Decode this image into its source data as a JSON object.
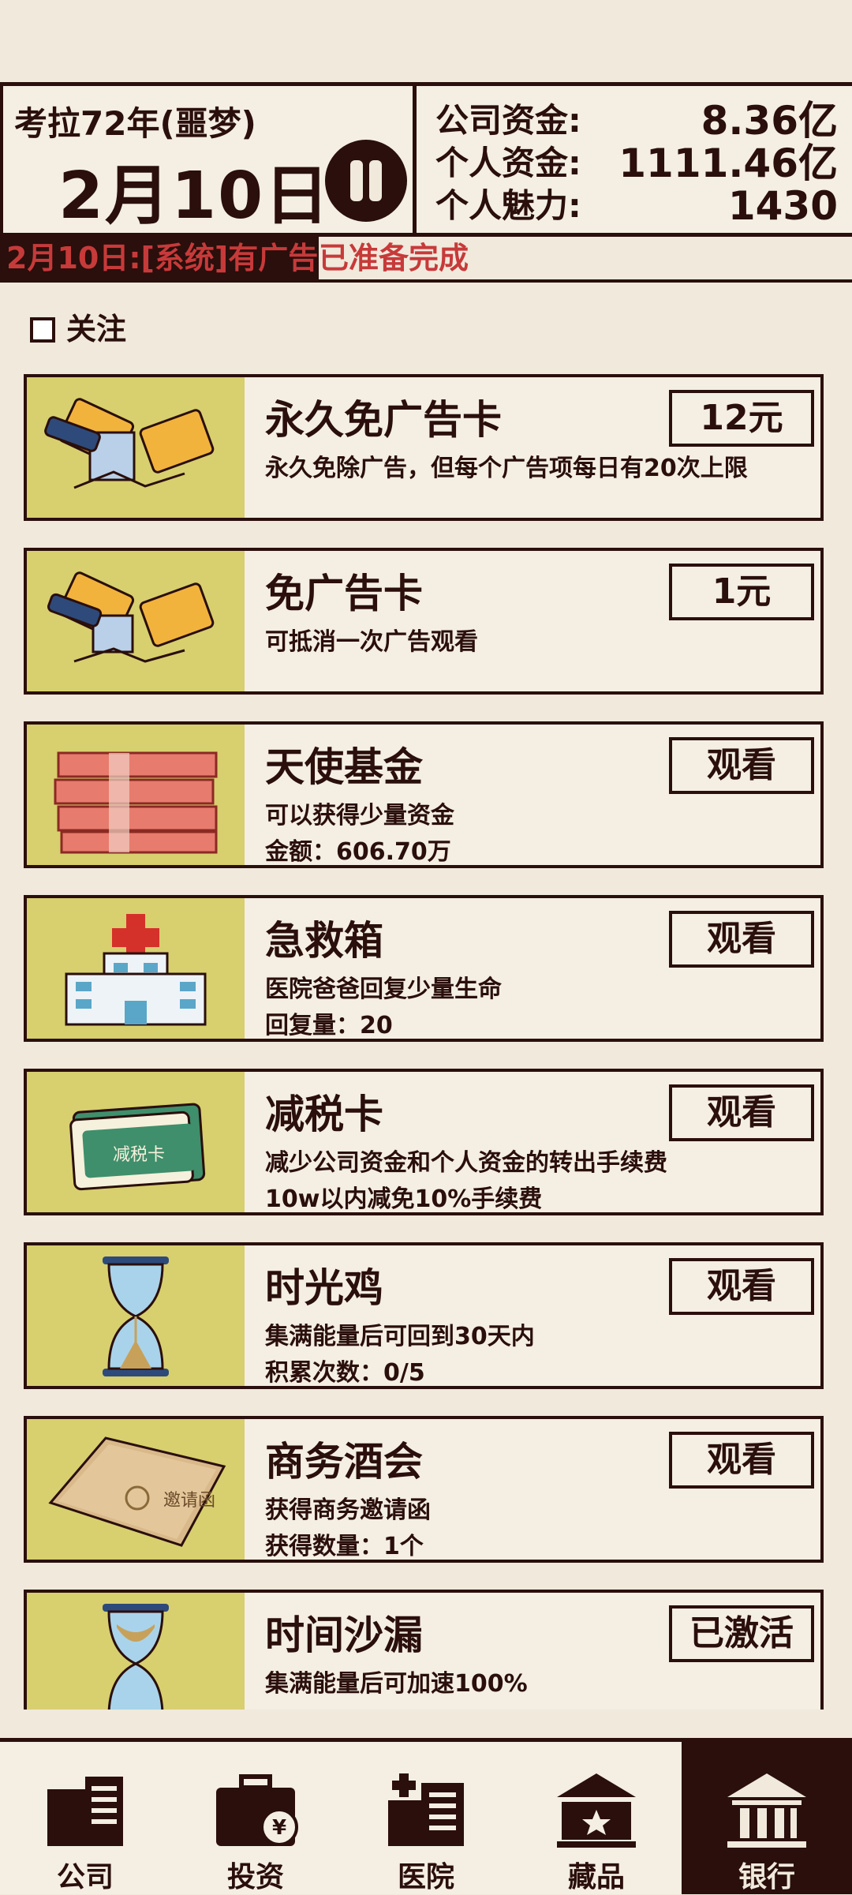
{
  "header": {
    "year_label": "考拉72年(噩梦)",
    "date": "2月10日",
    "stats": [
      {
        "label": "公司资金:",
        "value": "8.36亿"
      },
      {
        "label": "个人资金:",
        "value": "1111.46亿"
      },
      {
        "label": "个人魅力:",
        "value": "1430"
      }
    ]
  },
  "ticker": {
    "prefix": "2月10日:[系统]有广告",
    "suffix": "已准备完成"
  },
  "follow_label": "关注",
  "cards": [
    {
      "title": "永久免广告卡",
      "desc": "永久免除广告，但每个广告项每日有20次上限",
      "desc2": "",
      "button": "12元",
      "icon": "ad-card-permanent-icon"
    },
    {
      "title": "免广告卡",
      "desc": "可抵消一次广告观看",
      "desc2": "",
      "button": "1元",
      "icon": "ad-card-icon"
    },
    {
      "title": "天使基金",
      "desc": "可以获得少量资金",
      "desc2": "金额：606.70万",
      "button": "观看",
      "icon": "money-stack-icon"
    },
    {
      "title": "急救箱",
      "desc": "医院爸爸回复少量生命",
      "desc2": "回复量：20",
      "button": "观看",
      "icon": "hospital-icon"
    },
    {
      "title": "减税卡",
      "desc": "减少公司资金和个人资金的转出手续费",
      "desc2": "10w以内减免10%手续费",
      "button": "观看",
      "icon": "tax-card-icon",
      "icon_text": "减税卡"
    },
    {
      "title": "时光鸡",
      "desc": "集满能量后可回到30天内",
      "desc2": "积累次数：0/5",
      "button": "观看",
      "icon": "hourglass-icon"
    },
    {
      "title": "商务酒会",
      "desc": "获得商务邀请函",
      "desc2": "获得数量：1个",
      "button": "观看",
      "icon": "invitation-letter-icon",
      "icon_text": "邀请函"
    },
    {
      "title": "时间沙漏",
      "desc": "集满能量后可加速100%",
      "desc2": "",
      "button": "已激活",
      "icon": "hourglass-icon"
    }
  ],
  "tabs": [
    {
      "label": "公司",
      "icon": "company-building-icon"
    },
    {
      "label": "投资",
      "icon": "briefcase-yen-icon"
    },
    {
      "label": "医院",
      "icon": "hospital-building-icon"
    },
    {
      "label": "藏品",
      "icon": "museum-star-icon"
    },
    {
      "label": "银行",
      "icon": "bank-icon"
    }
  ],
  "colors": {
    "ink": "#2a0f0c",
    "background": "#f0e9dc",
    "icon_bg": "#d8cf6f",
    "alert_red": "#c73a3a"
  }
}
